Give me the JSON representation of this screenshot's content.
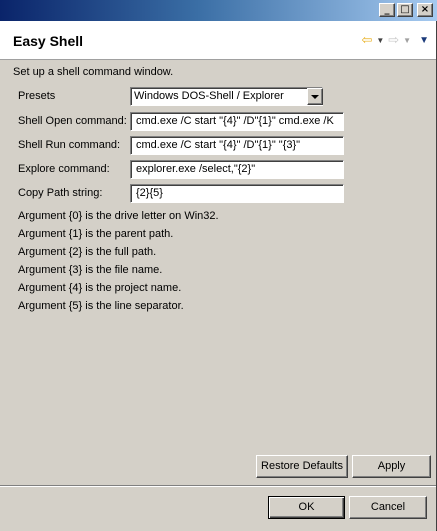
{
  "window": {
    "controls": {
      "minimize": "_",
      "maximize": "□",
      "close": "×"
    }
  },
  "header": {
    "title": "Easy Shell",
    "icons": [
      "back-arrow-icon",
      "back-dropdown-icon",
      "forward-arrow-icon",
      "forward-dropdown-icon",
      "view-menu-icon"
    ]
  },
  "description": "Set up a shell command window.",
  "form": {
    "presets_label": "Presets",
    "presets_value": "Windows DOS-Shell / Explorer",
    "open_label": "Shell Open command:",
    "open_value": "cmd.exe /C start \"{4}\" /D\"{1}\" cmd.exe /K",
    "run_label": "Shell Run command:",
    "run_value": "cmd.exe /C start \"{4}\" /D\"{1}\" \"{3}\"",
    "explore_label": "Explore command:",
    "explore_value": "explorer.exe /select,\"{2}\"",
    "copy_label": "Copy Path string:",
    "copy_value": "{2}{5}"
  },
  "arguments": [
    "Argument {0} is the drive letter on Win32.",
    "Argument {1} is the parent path.",
    "Argument {2} is the full path.",
    "Argument {3} is the file name.",
    "Argument {4} is the project name.",
    "Argument {5} is the line separator."
  ],
  "buttons": {
    "restore_defaults": "Restore Defaults",
    "apply": "Apply",
    "ok": "OK",
    "cancel": "Cancel"
  }
}
